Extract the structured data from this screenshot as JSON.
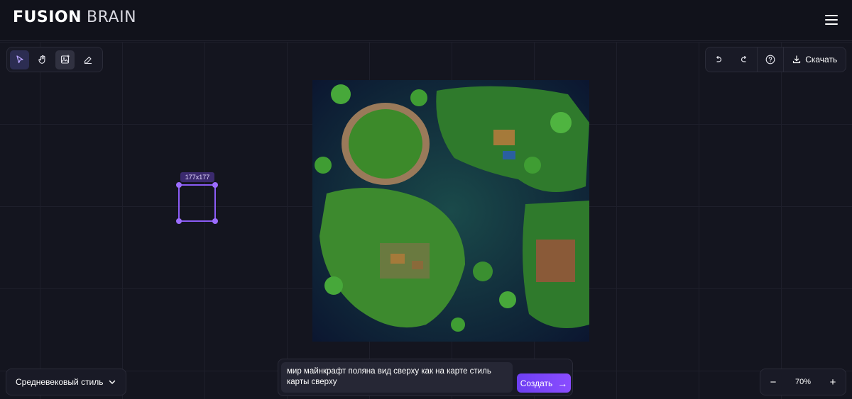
{
  "header": {
    "logo_bold": "FUSION",
    "logo_light": "BRAIN",
    "menu_icon": "hamburger-menu-icon"
  },
  "toolbar": {
    "tools": [
      "pointer-icon",
      "hand-icon",
      "image-add-icon",
      "eraser-icon"
    ],
    "active_tool": "pointer-icon",
    "selected_tool": "image-add-icon"
  },
  "right_toolbar": {
    "undo_icon": "undo-icon",
    "redo_icon": "redo-icon",
    "help_icon": "help-icon",
    "download_label": "Скачать"
  },
  "selection": {
    "size_label": "177x177"
  },
  "style_select": {
    "value": "Средневековый стиль"
  },
  "prompt": {
    "text": "мир майнкрафт поляна вид сверху как на карте стиль карты сверху",
    "submit_label": "Создать"
  },
  "zoom": {
    "minus": "−",
    "plus": "+",
    "value": "70%"
  },
  "colors": {
    "accent": "#8b5cf6",
    "background": "#14151f"
  }
}
